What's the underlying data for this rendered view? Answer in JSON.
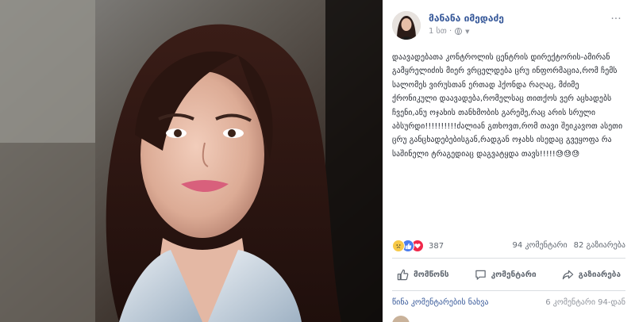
{
  "post": {
    "author": "მანანა იმედაძე",
    "time": "1 სთ ·",
    "text": "დაავადებათა კონტროლის ცენტრის დირექტორის-ამირან გამყრელიძის მიერ ვრცელდება ცრუ ინფორმაცია,რომ ჩემს სალომეს ვირუსთან ერთად ჰქონდა რაღაც, მძიმე ქრონიკული დაავადება,რომელსაც თითქოს ვერ აცხადებს ჩვენი,ანუ ოჯახის თანხმობის გარეშე,რაც არის სრული აბსურდი!!!!!!!!!!ძალიან გთხოვთ,რომ თავი შეიკავოთ ასეთი ცრუ განცხადებებისგან,რადგან ოჯახს ისედაც გვეყოფა რა საშინელი ტრაგედიაც დაგვატყდა თავს!!!!!😓😓😓"
  },
  "stats": {
    "reaction_count": "387",
    "comments": "94 კომენტარი",
    "shares": "82 გაზიარება"
  },
  "actions": {
    "like": "მომწონს",
    "comment": "კომენტარი",
    "share": "გაზიარება"
  },
  "comments_bar": {
    "previous": "წინა კომენტარების ნახვა",
    "count": "6 კომენტარი 94-დან"
  },
  "icons": {
    "more": "more-horizontal-icon",
    "privacy": "globe-icon",
    "like": "thumbs-up-icon",
    "comment": "speech-bubble-icon",
    "share": "share-arrow-icon"
  },
  "colors": {
    "link": "#365899",
    "muted": "#90949c",
    "text": "#1d2129"
  }
}
